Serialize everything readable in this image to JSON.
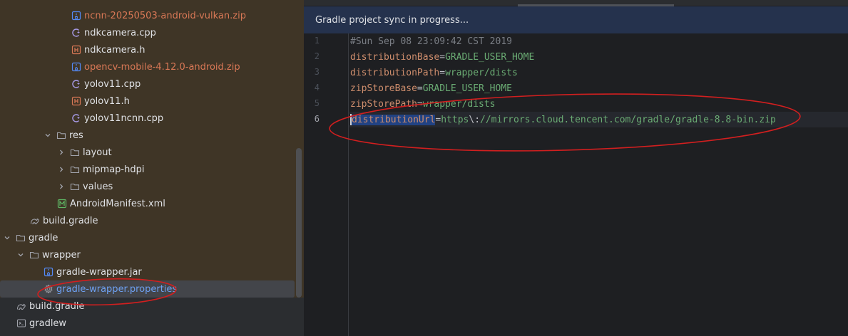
{
  "project_tree": {
    "items": [
      {
        "label": "ncnn-20250503-android-vulkan.zip",
        "icon": "archive-icon",
        "color": "orange"
      },
      {
        "label": "ndkcamera.cpp",
        "icon": "cpp-file-icon",
        "color": "default"
      },
      {
        "label": "ndkcamera.h",
        "icon": "header-file-icon",
        "color": "default"
      },
      {
        "label": "opencv-mobile-4.12.0-android.zip",
        "icon": "archive-icon",
        "color": "orange"
      },
      {
        "label": "yolov11.cpp",
        "icon": "cpp-file-icon",
        "color": "default"
      },
      {
        "label": "yolov11.h",
        "icon": "header-file-icon",
        "color": "default"
      },
      {
        "label": "yolov11ncnn.cpp",
        "icon": "cpp-file-icon",
        "color": "default"
      },
      {
        "label": "res",
        "icon": "folder-icon",
        "expanded": true
      },
      {
        "label": "layout",
        "icon": "folder-icon",
        "expanded": false
      },
      {
        "label": "mipmap-hdpi",
        "icon": "folder-icon",
        "expanded": false
      },
      {
        "label": "values",
        "icon": "folder-icon",
        "expanded": false
      },
      {
        "label": "AndroidManifest.xml",
        "icon": "manifest-icon",
        "color": "default"
      },
      {
        "label": "build.gradle",
        "icon": "gradle-icon",
        "color": "default"
      },
      {
        "label": "gradle",
        "icon": "folder-icon",
        "expanded": true
      },
      {
        "label": "wrapper",
        "icon": "folder-icon",
        "expanded": true
      },
      {
        "label": "gradle-wrapper.jar",
        "icon": "archive-icon",
        "color": "default"
      },
      {
        "label": "gradle-wrapper.properties",
        "icon": "settings-file-icon",
        "color": "blue",
        "selected": true
      },
      {
        "label": "build.gradle",
        "icon": "gradle-icon",
        "color": "default"
      },
      {
        "label": "gradlew",
        "icon": "terminal-icon",
        "color": "default"
      }
    ]
  },
  "banner": {
    "text": "Gradle project sync in progress..."
  },
  "editor": {
    "current_line": 6,
    "lines": [
      {
        "number": "1",
        "comment": "#Sun Sep 08 23:09:42 CST 2019"
      },
      {
        "number": "2",
        "key": "distributionBase",
        "eq": "=",
        "value": "GRADLE_USER_HOME"
      },
      {
        "number": "3",
        "key": "distributionPath",
        "eq": "=",
        "value": "wrapper/dists"
      },
      {
        "number": "4",
        "key": "zipStoreBase",
        "eq": "=",
        "value": "GRADLE_USER_HOME"
      },
      {
        "number": "5",
        "key": "zipStorePath",
        "eq": "=",
        "value": "wrapper/dists"
      },
      {
        "number": "6",
        "key": "distributionUrl",
        "eq": "=",
        "value_a": "https",
        "escape": "\\:",
        "value_b": "//mirrors.cloud.tencent.com/gradle/gradle-8.8-bin.zip"
      }
    ]
  },
  "colors": {
    "annotation": "#d21f1f",
    "tree_background": "#3f3526",
    "banner_background": "#25324d",
    "selection": "#214283"
  }
}
